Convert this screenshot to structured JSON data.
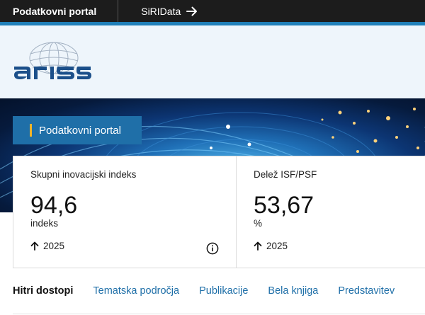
{
  "topbar": {
    "portal_label": "Podatkovni portal",
    "siridata_label": "SiRIData",
    "siridata_icon": "arrow-right-icon"
  },
  "header": {
    "logo_text": "aris",
    "logo_color": "#1b4f8a"
  },
  "hero": {
    "badge_label": "Podatkovni portal",
    "badge_accent": "#f0b429"
  },
  "cards": [
    {
      "label": "Skupni inovacijski indeks",
      "value": "94,6",
      "unit": "indeks",
      "year": "2025",
      "trend_icon": "arrow-up-icon",
      "info_icon": "info-icon"
    },
    {
      "label": "Delež ISF/PSF",
      "value": "53,67",
      "unit": "%",
      "year": "2025",
      "trend_icon": "arrow-up-icon"
    }
  ],
  "quick_links": {
    "title": "Hitri dostopi",
    "links": [
      "Tematska področja",
      "Publikacije",
      "Bela knjiga",
      "Predstavitev"
    ]
  },
  "colors": {
    "topbar_bg": "#1c1c1c",
    "accent_blue": "#1f7fb8",
    "link_blue": "#1f6fa8",
    "header_bg": "#eef5fb"
  }
}
